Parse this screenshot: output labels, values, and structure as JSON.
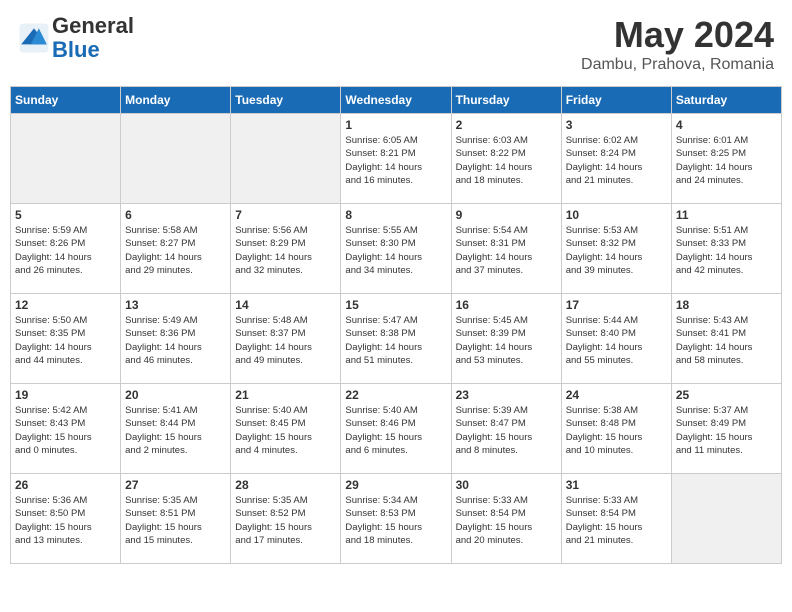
{
  "header": {
    "logo_line1": "General",
    "logo_line2": "Blue",
    "month": "May 2024",
    "location": "Dambu, Prahova, Romania"
  },
  "weekdays": [
    "Sunday",
    "Monday",
    "Tuesday",
    "Wednesday",
    "Thursday",
    "Friday",
    "Saturday"
  ],
  "weeks": [
    [
      {
        "day": "",
        "info": ""
      },
      {
        "day": "",
        "info": ""
      },
      {
        "day": "",
        "info": ""
      },
      {
        "day": "1",
        "info": "Sunrise: 6:05 AM\nSunset: 8:21 PM\nDaylight: 14 hours\nand 16 minutes."
      },
      {
        "day": "2",
        "info": "Sunrise: 6:03 AM\nSunset: 8:22 PM\nDaylight: 14 hours\nand 18 minutes."
      },
      {
        "day": "3",
        "info": "Sunrise: 6:02 AM\nSunset: 8:24 PM\nDaylight: 14 hours\nand 21 minutes."
      },
      {
        "day": "4",
        "info": "Sunrise: 6:01 AM\nSunset: 8:25 PM\nDaylight: 14 hours\nand 24 minutes."
      }
    ],
    [
      {
        "day": "5",
        "info": "Sunrise: 5:59 AM\nSunset: 8:26 PM\nDaylight: 14 hours\nand 26 minutes."
      },
      {
        "day": "6",
        "info": "Sunrise: 5:58 AM\nSunset: 8:27 PM\nDaylight: 14 hours\nand 29 minutes."
      },
      {
        "day": "7",
        "info": "Sunrise: 5:56 AM\nSunset: 8:29 PM\nDaylight: 14 hours\nand 32 minutes."
      },
      {
        "day": "8",
        "info": "Sunrise: 5:55 AM\nSunset: 8:30 PM\nDaylight: 14 hours\nand 34 minutes."
      },
      {
        "day": "9",
        "info": "Sunrise: 5:54 AM\nSunset: 8:31 PM\nDaylight: 14 hours\nand 37 minutes."
      },
      {
        "day": "10",
        "info": "Sunrise: 5:53 AM\nSunset: 8:32 PM\nDaylight: 14 hours\nand 39 minutes."
      },
      {
        "day": "11",
        "info": "Sunrise: 5:51 AM\nSunset: 8:33 PM\nDaylight: 14 hours\nand 42 minutes."
      }
    ],
    [
      {
        "day": "12",
        "info": "Sunrise: 5:50 AM\nSunset: 8:35 PM\nDaylight: 14 hours\nand 44 minutes."
      },
      {
        "day": "13",
        "info": "Sunrise: 5:49 AM\nSunset: 8:36 PM\nDaylight: 14 hours\nand 46 minutes."
      },
      {
        "day": "14",
        "info": "Sunrise: 5:48 AM\nSunset: 8:37 PM\nDaylight: 14 hours\nand 49 minutes."
      },
      {
        "day": "15",
        "info": "Sunrise: 5:47 AM\nSunset: 8:38 PM\nDaylight: 14 hours\nand 51 minutes."
      },
      {
        "day": "16",
        "info": "Sunrise: 5:45 AM\nSunset: 8:39 PM\nDaylight: 14 hours\nand 53 minutes."
      },
      {
        "day": "17",
        "info": "Sunrise: 5:44 AM\nSunset: 8:40 PM\nDaylight: 14 hours\nand 55 minutes."
      },
      {
        "day": "18",
        "info": "Sunrise: 5:43 AM\nSunset: 8:41 PM\nDaylight: 14 hours\nand 58 minutes."
      }
    ],
    [
      {
        "day": "19",
        "info": "Sunrise: 5:42 AM\nSunset: 8:43 PM\nDaylight: 15 hours\nand 0 minutes."
      },
      {
        "day": "20",
        "info": "Sunrise: 5:41 AM\nSunset: 8:44 PM\nDaylight: 15 hours\nand 2 minutes."
      },
      {
        "day": "21",
        "info": "Sunrise: 5:40 AM\nSunset: 8:45 PM\nDaylight: 15 hours\nand 4 minutes."
      },
      {
        "day": "22",
        "info": "Sunrise: 5:40 AM\nSunset: 8:46 PM\nDaylight: 15 hours\nand 6 minutes."
      },
      {
        "day": "23",
        "info": "Sunrise: 5:39 AM\nSunset: 8:47 PM\nDaylight: 15 hours\nand 8 minutes."
      },
      {
        "day": "24",
        "info": "Sunrise: 5:38 AM\nSunset: 8:48 PM\nDaylight: 15 hours\nand 10 minutes."
      },
      {
        "day": "25",
        "info": "Sunrise: 5:37 AM\nSunset: 8:49 PM\nDaylight: 15 hours\nand 11 minutes."
      }
    ],
    [
      {
        "day": "26",
        "info": "Sunrise: 5:36 AM\nSunset: 8:50 PM\nDaylight: 15 hours\nand 13 minutes."
      },
      {
        "day": "27",
        "info": "Sunrise: 5:35 AM\nSunset: 8:51 PM\nDaylight: 15 hours\nand 15 minutes."
      },
      {
        "day": "28",
        "info": "Sunrise: 5:35 AM\nSunset: 8:52 PM\nDaylight: 15 hours\nand 17 minutes."
      },
      {
        "day": "29",
        "info": "Sunrise: 5:34 AM\nSunset: 8:53 PM\nDaylight: 15 hours\nand 18 minutes."
      },
      {
        "day": "30",
        "info": "Sunrise: 5:33 AM\nSunset: 8:54 PM\nDaylight: 15 hours\nand 20 minutes."
      },
      {
        "day": "31",
        "info": "Sunrise: 5:33 AM\nSunset: 8:54 PM\nDaylight: 15 hours\nand 21 minutes."
      },
      {
        "day": "",
        "info": ""
      }
    ]
  ]
}
